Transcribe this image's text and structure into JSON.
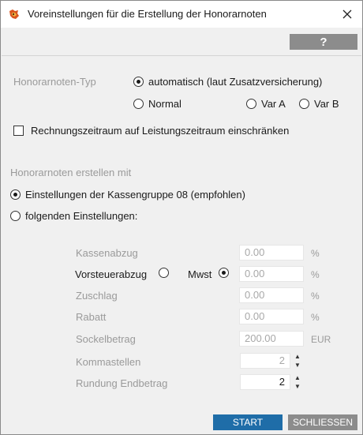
{
  "window": {
    "title": "Voreinstellungen für die Erstellung der Honorarnoten",
    "icon": "app-icon",
    "close_glyph": "✕"
  },
  "toolbar": {
    "help_label": "?"
  },
  "typ": {
    "label": "Honorarnoten-Typ",
    "options": [
      {
        "label": "automatisch (laut Zusatzversicherung)",
        "selected": true
      },
      {
        "label": "Normal",
        "selected": false
      },
      {
        "label": "Var A",
        "selected": false
      },
      {
        "label": "Var B",
        "selected": false
      }
    ]
  },
  "restrict_checkbox": {
    "label": "Rechnungszeitraum auf Leistungszeitraum einschränken",
    "checked": false
  },
  "erstellen": {
    "label": "Honorarnoten erstellen mit",
    "options": [
      {
        "label": "Einstellungen der Kassengruppe 08 (empfohlen)",
        "selected": true
      },
      {
        "label": "folgenden Einstellungen:",
        "selected": false
      }
    ]
  },
  "settings": {
    "kassenabzug": {
      "label": "Kassenabzug",
      "value": "0.00",
      "unit": "%"
    },
    "vorsteuer": {
      "label": "Vorsteuerabzug",
      "selected": false
    },
    "mwst": {
      "label": "Mwst",
      "selected": true,
      "value": "0.00",
      "unit": "%"
    },
    "zuschlag": {
      "label": "Zuschlag",
      "value": "0.00",
      "unit": "%"
    },
    "rabatt": {
      "label": "Rabatt",
      "value": "0.00",
      "unit": "%"
    },
    "sockelbetrag": {
      "label": "Sockelbetrag",
      "value": "200.00",
      "unit": "EUR"
    },
    "kommastellen": {
      "label": "Kommastellen",
      "value": "2"
    },
    "rundung": {
      "label": "Rundung Endbetrag",
      "value": "2"
    }
  },
  "footer": {
    "start_label": "START",
    "close_label": "SCHLIESSEN"
  },
  "colors": {
    "primary": "#1f6da8",
    "secondary": "#8c8c8c",
    "muted_text": "#9a9a9a"
  }
}
